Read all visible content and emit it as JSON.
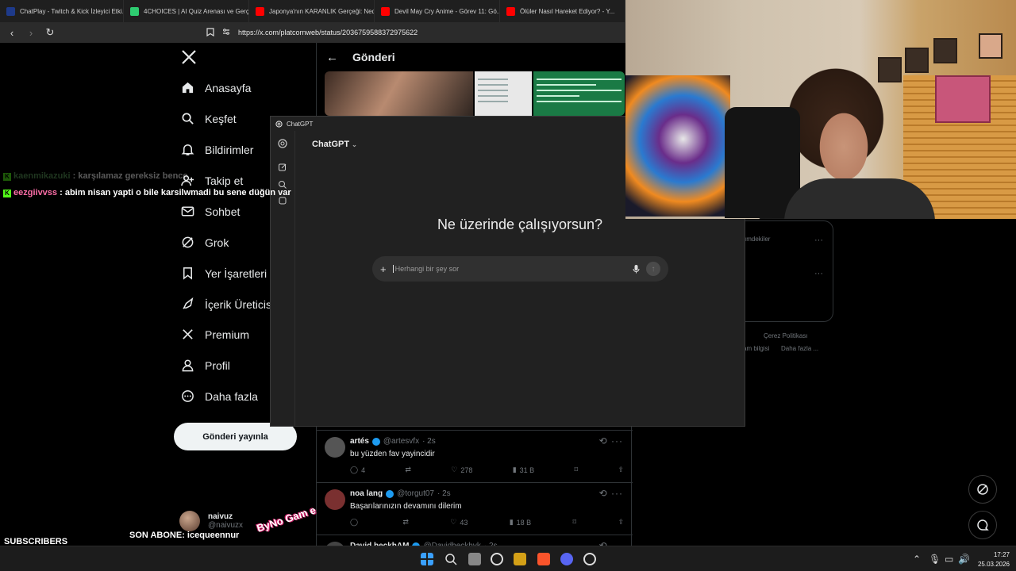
{
  "browser": {
    "tabs": [
      {
        "label": "ChatPlay - Twitch & Kick İzleyici Etki...",
        "favicon_color": "#1e3a8a"
      },
      {
        "label": "4CHOICES | AI Quiz Arenası ve Gerçe...",
        "favicon_color": "#2ecc71"
      },
      {
        "label": "Japonya'nın KARANLIK Gerçeği: Ned...",
        "favicon_color": "#ff0000"
      },
      {
        "label": "Devil May Cry Anime - Görev 11: Gö...",
        "favicon_color": "#ff0000"
      },
      {
        "label": "Ölüler Nasıl Hareket Ediyor? - Y...",
        "favicon_color": "#ff0000"
      }
    ],
    "url": "https://x.com/platcornweb/status/2036759588372975622"
  },
  "x_sidebar": {
    "items": [
      {
        "label": "Anasayfa",
        "icon": "home-icon"
      },
      {
        "label": "Keşfet",
        "icon": "search-icon"
      },
      {
        "label": "Bildirimler",
        "icon": "bell-icon"
      },
      {
        "label": "Takip et",
        "icon": "follow-icon"
      },
      {
        "label": "Sohbet",
        "icon": "mail-icon"
      },
      {
        "label": "Grok",
        "icon": "grok-icon"
      },
      {
        "label": "Yer İşaretleri",
        "icon": "bookmark-icon"
      },
      {
        "label": "İçerik Üreticisi",
        "icon": "rocket-icon"
      },
      {
        "label": "Premium",
        "icon": "x-icon"
      },
      {
        "label": "Profil",
        "icon": "person-icon"
      },
      {
        "label": "Daha fazla",
        "icon": "more-icon"
      }
    ],
    "post_button": "Gönderi yayınla",
    "profile": {
      "name": "naivuz",
      "handle": "@naivuzx"
    }
  },
  "center": {
    "header_title": "Gönderi",
    "replies": [
      {
        "name": "artés",
        "handle": "@artesvfx",
        "time": "· 2s",
        "text": "bu yüzden fav yayincidir",
        "replies": "4",
        "likes": "278",
        "views": "31 B",
        "avatar_color": "#555"
      },
      {
        "name": "noa lang",
        "handle": "@torgut07",
        "time": "· 2s",
        "text": "Başarılarınızın devamını dilerim",
        "replies": "",
        "likes": "43",
        "views": "18 B",
        "avatar_color": "#7a3030"
      },
      {
        "name": "David beckhAM",
        "handle": "@Davidbeckhvk",
        "time": "· 2s",
        "text": "",
        "replies": "",
        "likes": "",
        "views": "",
        "avatar_color": "#444"
      }
    ]
  },
  "right_fragments": {
    "whats_happening": "ımdekiler",
    "cookie_policy": "Çerez Politikası",
    "ad_info": "am bilgisi",
    "more": "Daha fazla ..."
  },
  "chatgpt": {
    "window_title": "ChatGPT",
    "model": "ChatGPT",
    "heading": "Ne üzerinde çalışıyorsun?",
    "input_placeholder": "Herhangi bir şey sor"
  },
  "overlay": {
    "chat": [
      {
        "user": "kaenmikazuki",
        "message": ": karşılamaz gereksiz bence",
        "color": "#5a9a5a",
        "faded": true
      },
      {
        "user": "eezgiivvss",
        "message": ": abim nisan yapti o bile karsilwmadi bu sene düğün var",
        "color": "#ff6ea8",
        "faded": false
      }
    ],
    "subscribers_label": "SUBSCRIBERS",
    "last_sub": "SON ABONE: icequeennur",
    "sticker": "ByNo Gam e"
  },
  "taskbar": {
    "time": "17:27",
    "date": "25.03.2026"
  }
}
